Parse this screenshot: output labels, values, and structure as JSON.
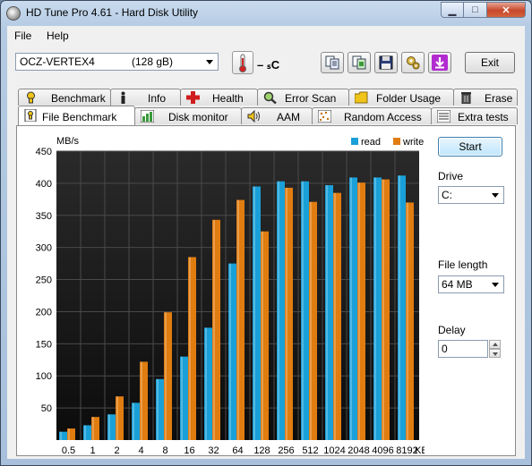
{
  "window": {
    "title": "HD Tune Pro 4.61 - Hard Disk Utility"
  },
  "menu": {
    "file": "File",
    "help": "Help"
  },
  "toolbar": {
    "drive_name": "OCZ-VERTEX4",
    "drive_size": "(128 gB)",
    "temperature": "– ₛC",
    "exit_label": "Exit"
  },
  "tabs_top": [
    "Benchmark",
    "Info",
    "Health",
    "Error Scan",
    "Folder Usage",
    "Erase"
  ],
  "tabs_bottom": [
    "File Benchmark",
    "Disk monitor",
    "AAM",
    "Random Access",
    "Extra tests"
  ],
  "active_tab": "File Benchmark",
  "controls": {
    "start_label": "Start",
    "drive_label": "Drive",
    "drive_value": "C:",
    "file_length_label": "File length",
    "file_length_value": "64 MB",
    "delay_label": "Delay",
    "delay_value": "0"
  },
  "colors": {
    "read": "#1aa0d8",
    "write": "#e07c10",
    "plot_bg": "#1c1c1c"
  },
  "chart_data": {
    "type": "bar",
    "ylabel": "MB/s",
    "xunit": "KB",
    "ylim": [
      0,
      450
    ],
    "yticks": [
      50,
      100,
      150,
      200,
      250,
      300,
      350,
      400,
      450
    ],
    "categories": [
      "0.5",
      "1",
      "2",
      "4",
      "8",
      "16",
      "32",
      "64",
      "128",
      "256",
      "512",
      "1024",
      "2048",
      "4096",
      "8192"
    ],
    "series": [
      {
        "name": "read",
        "values": [
          13,
          23,
          40,
          58,
          95,
          130,
          175,
          275,
          395,
          403,
          403,
          397,
          409,
          409,
          412
        ]
      },
      {
        "name": "write",
        "values": [
          18,
          36,
          68,
          122,
          199,
          285,
          343,
          374,
          325,
          393,
          371,
          385,
          401,
          406,
          370
        ]
      }
    ],
    "grid": true,
    "legend": "top-right"
  }
}
